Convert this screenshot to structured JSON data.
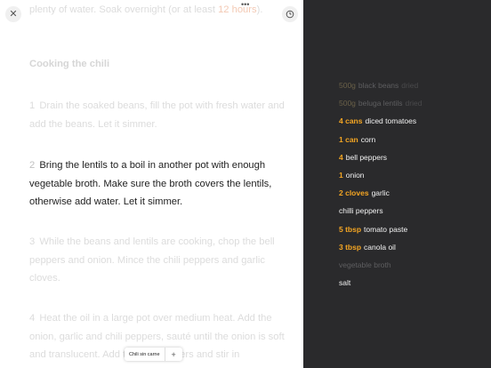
{
  "header": {
    "dots": "•••"
  },
  "instructions": {
    "top_line_prefix": "plenty of water. Soak overnight (or at least ",
    "top_line_highlight": "12 hours",
    "top_line_suffix": ").",
    "heading": "Cooking the chili",
    "steps": [
      {
        "num": "1",
        "text": "Drain the soaked beans, fill the pot with fresh water and add the beans. Let it simmer."
      },
      {
        "num": "2",
        "text": "Bring the lentils to a boil in another pot with enough vegetable broth. Make sure the broth covers the lentils, otherwise add water. Let it simmer."
      },
      {
        "num": "3",
        "text": "While the beans and lentils are cooking, chop the bell peppers and onion. Mince the chili peppers and garlic cloves."
      },
      {
        "num": "4",
        "text": "Heat the oil in a large pot over medium heat. Add the onion, garlic and chili peppers, sauté until the onion is soft and translucent. Add the bell peppers and stir in"
      }
    ]
  },
  "tabs": {
    "items": [
      "Chili sin carne"
    ],
    "add_label": "+"
  },
  "ingredients": [
    {
      "qty": "500g",
      "name": "black beans",
      "note": "dried",
      "dim": true
    },
    {
      "qty": "500g",
      "name": "beluga lentils",
      "note": "dried",
      "dim": true
    },
    {
      "qty": "4 cans",
      "name": "diced tomatoes",
      "note": "",
      "dim": false
    },
    {
      "qty": "1 can",
      "name": "corn",
      "note": "",
      "dim": false
    },
    {
      "qty": "4",
      "name": "bell peppers",
      "note": "",
      "dim": false
    },
    {
      "qty": "1",
      "name": "onion",
      "note": "",
      "dim": false
    },
    {
      "qty": "2 cloves",
      "name": "garlic",
      "note": "",
      "dim": false
    },
    {
      "qty": "",
      "name": "chilli peppers",
      "note": "",
      "dim": false
    },
    {
      "qty": "5 tbsp",
      "name": "tomato paste",
      "note": "",
      "dim": false
    },
    {
      "qty": "3 tbsp",
      "name": "canola oil",
      "note": "",
      "dim": false
    },
    {
      "qty": "",
      "name": "vegetable broth",
      "note": "",
      "dim": true
    },
    {
      "qty": "",
      "name": "salt",
      "note": "",
      "dim": false
    }
  ],
  "colors": {
    "accent": "#f5a623",
    "panel_dark": "#2a2a2c",
    "highlight_faint": "#f3c9b4"
  },
  "icons": {
    "close": "close-icon",
    "timer": "timer-icon"
  }
}
